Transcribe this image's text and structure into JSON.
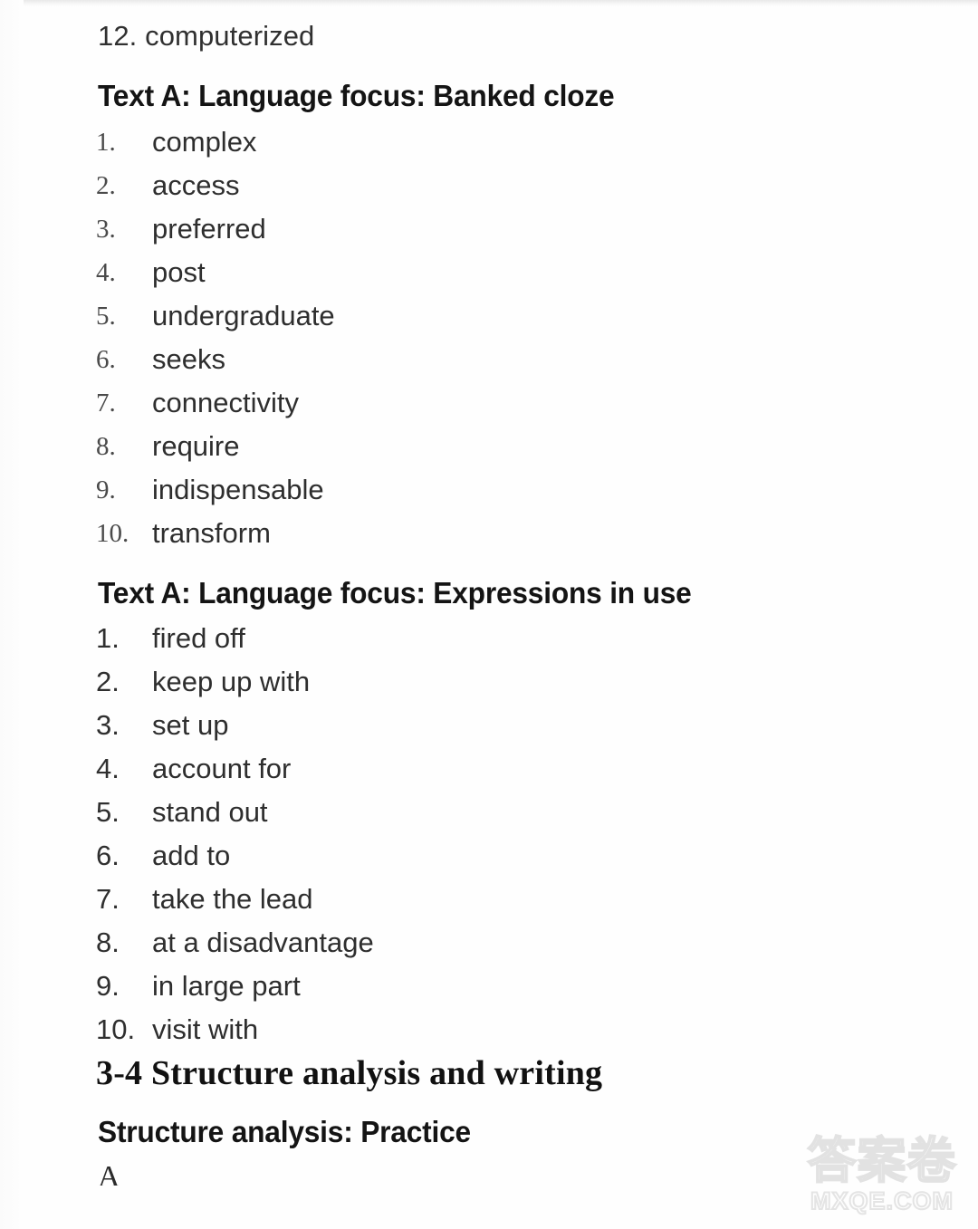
{
  "page": {
    "background_color": "#fefefe",
    "text_color": "#2b2b2b"
  },
  "carryover_item": {
    "number": "12.",
    "text": "computerized",
    "full": "12. computerized"
  },
  "sections": [
    {
      "heading": "Text A: Language focus: Banked cloze",
      "numeral_style": "serif",
      "items": [
        {
          "number": "1.",
          "text": "complex"
        },
        {
          "number": "2.",
          "text": "access"
        },
        {
          "number": "3.",
          "text": "preferred"
        },
        {
          "number": "4.",
          "text": "post"
        },
        {
          "number": "5.",
          "text": "undergraduate"
        },
        {
          "number": "6.",
          "text": "seeks"
        },
        {
          "number": "7.",
          "text": "connectivity"
        },
        {
          "number": "8.",
          "text": "require"
        },
        {
          "number": "9.",
          "text": "indispensable"
        },
        {
          "number": "10.",
          "text": "transform"
        }
      ]
    },
    {
      "heading": "Text A: Language focus: Expressions in use",
      "numeral_style": "sans",
      "items": [
        {
          "number": "1.",
          "text": "fired off"
        },
        {
          "number": "2.",
          "text": "keep up with"
        },
        {
          "number": "3.",
          "text": "set up"
        },
        {
          "number": "4.",
          "text": "account for"
        },
        {
          "number": "5.",
          "text": "stand out"
        },
        {
          "number": "6.",
          "text": "add to"
        },
        {
          "number": "7.",
          "text": "take the lead"
        },
        {
          "number": "8.",
          "text": "at a disadvantage"
        },
        {
          "number": "9.",
          "text": "in large part"
        },
        {
          "number": "10.",
          "text": "visit with"
        }
      ]
    }
  ],
  "unit_heading": "3-4 Structure analysis and writing",
  "practice_heading": "Structure analysis: Practice",
  "trailing_letter": "A",
  "watermark": {
    "chinese": "答案卷",
    "domain": "MXQE.COM",
    "stroke_color": "#e3e3e3"
  }
}
